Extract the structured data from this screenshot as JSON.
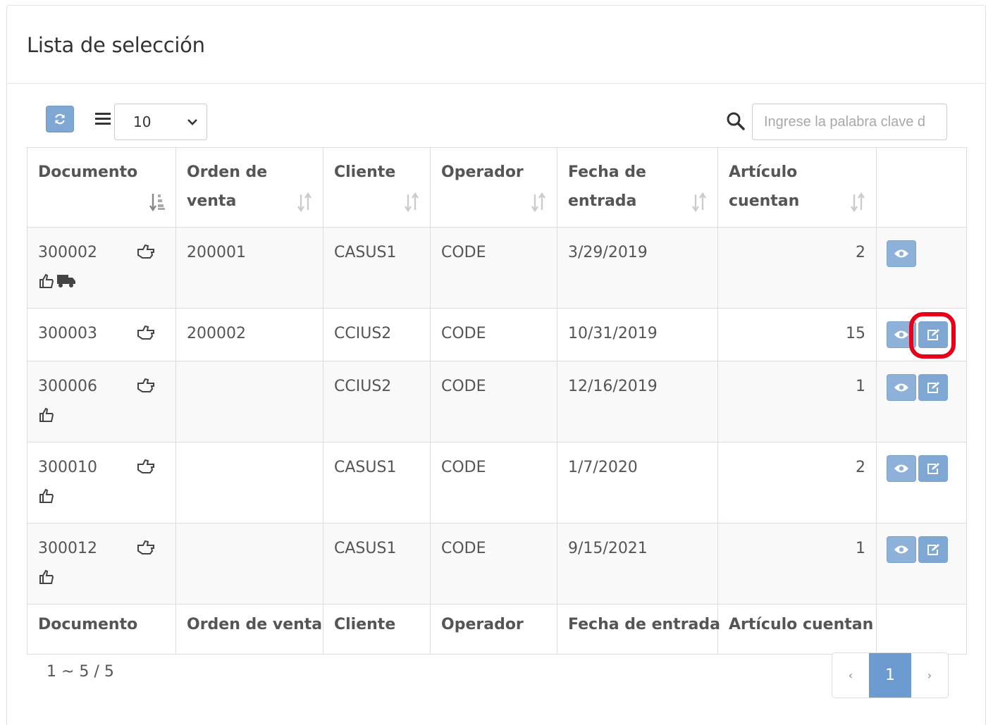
{
  "panel": {
    "title": "Lista de selección"
  },
  "toolbar": {
    "page_size": "10",
    "search_placeholder": "Ingrese la palabra clave d"
  },
  "table": {
    "headers": [
      {
        "line1": "",
        "line2": "Documento",
        "sort": "active-asc"
      },
      {
        "line1": "Orden de",
        "line2": "venta",
        "sort": "both"
      },
      {
        "line1": "",
        "line2": "Cliente",
        "sort": "both"
      },
      {
        "line1": "",
        "line2": "Operador",
        "sort": "both"
      },
      {
        "line1": "Fecha de",
        "line2": "entrada",
        "sort": "both"
      },
      {
        "line1": "Artículo",
        "line2": "cuentan",
        "sort": "both"
      },
      {
        "line1": "",
        "line2": "",
        "sort": "none"
      }
    ],
    "rows": [
      {
        "documento": "300002",
        "orden": "200001",
        "cliente": "CASUS1",
        "operador": "CODE",
        "fecha": "3/29/2019",
        "cuentan": "2"
      },
      {
        "documento": "300003",
        "orden": "200002",
        "cliente": "CCIUS2",
        "operador": "CODE",
        "fecha": "10/31/2019",
        "cuentan": "15"
      },
      {
        "documento": "300006",
        "orden": "",
        "cliente": "CCIUS2",
        "operador": "CODE",
        "fecha": "12/16/2019",
        "cuentan": "1"
      },
      {
        "documento": "300010",
        "orden": "",
        "cliente": "CASUS1",
        "operador": "CODE",
        "fecha": "1/7/2020",
        "cuentan": "2"
      },
      {
        "documento": "300012",
        "orden": "",
        "cliente": "CASUS1",
        "operador": "CODE",
        "fecha": "9/15/2021",
        "cuentan": "1"
      }
    ],
    "footer": [
      "Documento",
      "Orden de venta",
      "Cliente",
      "Operador",
      "Fecha de entrada",
      "Artículo cuentan",
      ""
    ]
  },
  "pagination": {
    "info": "1 ~ 5 / 5",
    "prev": "‹",
    "current": "1",
    "next": "›"
  },
  "colors": {
    "button": "#8eb1d9",
    "active_page": "#6b9bd1",
    "highlight": "#e8001a"
  }
}
